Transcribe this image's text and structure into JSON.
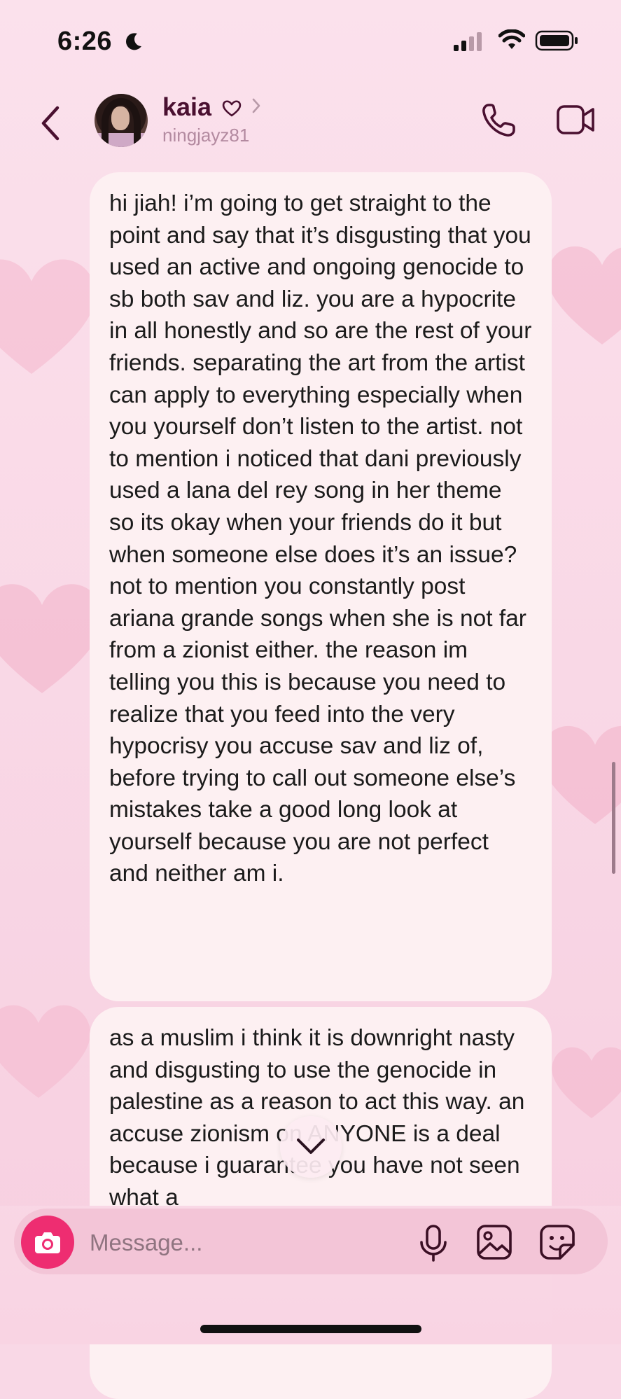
{
  "status_bar": {
    "time": "6:26"
  },
  "header": {
    "contact_name": "kaia",
    "username": "ningjayz81"
  },
  "messages": [
    {
      "sender": "other",
      "text": "hi jiah! i’m going to get straight to the point and say that it’s disgusting that you used an active and ongoing genocide to sb both sav and liz. you are a hypocrite in all honestly and so are the rest of your friends. separating the art from the artist can apply to everything especially when you yourself don’t listen to the artist. not to mention i noticed that dani previously used a lana del rey song in her theme so its okay when your friends do it but when someone else does it’s an issue? not to mention you constantly post ariana grande songs when she is not far from a zionist either. the reason im telling you this is because you need to realize that you feed into the very hypocrisy you accuse sav and liz of, before trying to call out someone else’s mistakes take a good long look at yourself because you are not perfect and neither am i."
    },
    {
      "sender": "other",
      "text": "as a muslim i think it is downright nasty and disgusting to use the genocide in palestine as a reason to act this way. an   accuse zionism on ANYONE is a   deal because i guarantee you have not seen what a"
    }
  ],
  "composer": {
    "placeholder": "Message..."
  },
  "icons": {
    "back": "chevron-left-icon",
    "call": "phone-icon",
    "video": "video-camera-icon",
    "camera": "camera-icon",
    "mic": "microphone-icon",
    "gallery": "image-icon",
    "sticker": "sticker-icon",
    "scroll_down": "chevron-down-icon"
  },
  "colors": {
    "accent": "#ee2d71",
    "name": "#4a1030",
    "background": "#f9d8e6",
    "bubble": "#fdf0f2"
  }
}
